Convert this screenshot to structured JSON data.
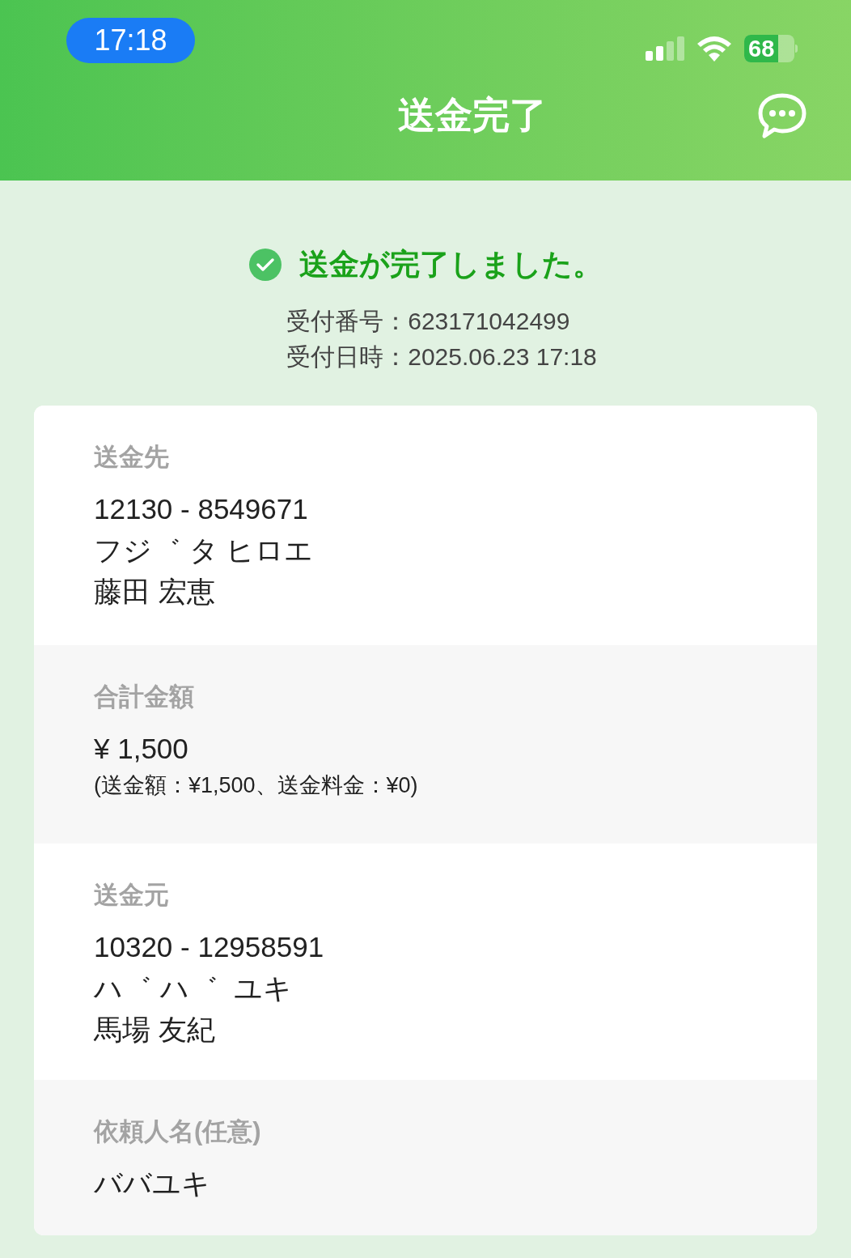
{
  "status_bar": {
    "time": "17:18",
    "battery": "68"
  },
  "header": {
    "title": "送金完了"
  },
  "result": {
    "message": "送金が完了しました。",
    "details": [
      "受付番号：623171042499",
      "受付日時：2025.06.23 17:18"
    ]
  },
  "sections": [
    {
      "label": "送金先",
      "lines": [
        {
          "kind": "large",
          "text": "12130 - 8549671"
        },
        {
          "kind": "large",
          "text": "フジ゛ タ ヒロエ"
        },
        {
          "kind": "large",
          "text": "藤田 宏恵"
        }
      ]
    },
    {
      "label": "合計金額",
      "lines": [
        {
          "kind": "large",
          "text": "¥ 1,500"
        },
        {
          "kind": "small",
          "text": "(送金額：¥1,500、送金料金：¥0)"
        }
      ]
    },
    {
      "label": "送金元",
      "lines": [
        {
          "kind": "large",
          "text": "10320 - 12958591"
        },
        {
          "kind": "large",
          "text": "ハ゛ ハ゛  ユキ"
        },
        {
          "kind": "large",
          "text": "馬場 友紀"
        }
      ]
    },
    {
      "label": "依頼人名(任意)",
      "lines": [
        {
          "kind": "large",
          "text": "ババユキ"
        }
      ]
    }
  ]
}
